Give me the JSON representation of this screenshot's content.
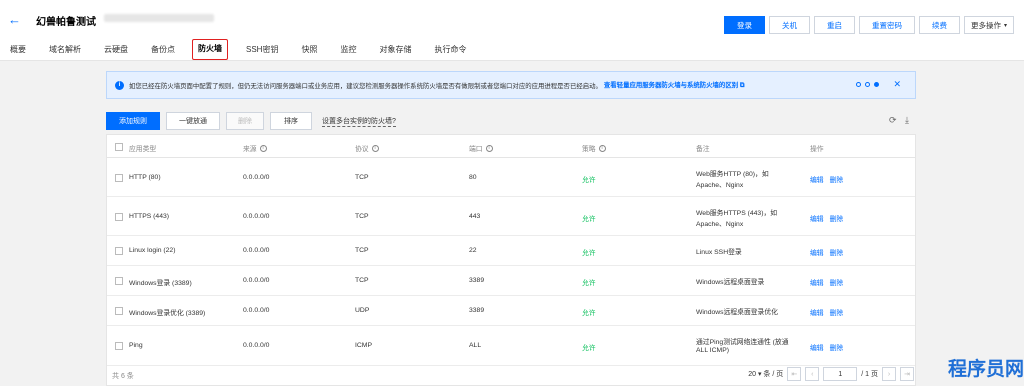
{
  "header": {
    "back_icon": "arrow-left-icon",
    "title": "幻兽帕鲁测试",
    "buttons": {
      "login": "登录",
      "shutdown": "关机",
      "restart": "重启",
      "reset_password": "重置密码",
      "renew": "续费",
      "more": "更多操作"
    }
  },
  "tabs": [
    "概要",
    "域名解析",
    "云硬盘",
    "备份点",
    "防火墙",
    "SSH密钥",
    "快照",
    "监控",
    "对象存储",
    "执行命令"
  ],
  "active_tab": "防火墙",
  "notice": {
    "text": "如您已经在防火墙页面中配置了规则，但仍无法访问服务器端口或业务应用，建议您检测服务器操作系统防火墙是否有做限制或者您端口对应的应用进程是否已经启动。",
    "link": "查看轻量应用服务器防火墙与系统防火墙的区别 ⧉"
  },
  "toolbar": {
    "add_rule": "添加规则",
    "allow_all": "一键放通",
    "delete": "删除",
    "sort": "排序",
    "multi_instance": "设置多台实例的防火墙?"
  },
  "table": {
    "columns": {
      "type": "应用类型",
      "source": "来源",
      "protocol": "协议",
      "port": "端口",
      "policy": "策略",
      "remark": "备注",
      "actions": "操作"
    },
    "action_edit": "编辑",
    "action_delete": "删除",
    "rows": [
      {
        "type": "HTTP (80)",
        "source": "0.0.0.0/0",
        "protocol": "TCP",
        "port": "80",
        "policy": "允许",
        "remark1": "Web服务HTTP (80)，如",
        "remark2": "Apache、Nginx"
      },
      {
        "type": "HTTPS (443)",
        "source": "0.0.0.0/0",
        "protocol": "TCP",
        "port": "443",
        "policy": "允许",
        "remark1": "Web服务HTTPS (443)，如",
        "remark2": "Apache、Nginx"
      },
      {
        "type": "Linux login (22)",
        "source": "0.0.0.0/0",
        "protocol": "TCP",
        "port": "22",
        "policy": "允许",
        "remark1": "Linux SSH登录",
        "remark2": ""
      },
      {
        "type": "Windows登录 (3389)",
        "source": "0.0.0.0/0",
        "protocol": "TCP",
        "port": "3389",
        "policy": "允许",
        "remark1": "Windows远程桌面登录",
        "remark2": ""
      },
      {
        "type": "Windows登录优化 (3389)",
        "source": "0.0.0.0/0",
        "protocol": "UDP",
        "port": "3389",
        "policy": "允许",
        "remark1": "Windows远程桌面登录优化",
        "remark2": ""
      },
      {
        "type": "Ping",
        "source": "0.0.0.0/0",
        "protocol": "ICMP",
        "port": "ALL",
        "policy": "允许",
        "remark1": "通过Ping测试网络连通性 (放通",
        "remark2": "ALL ICMP)"
      }
    ]
  },
  "footer": {
    "total": "共 6 条",
    "page_size": "20 ▾ 条 / 页",
    "page": "1",
    "page_total": "/ 1 页"
  },
  "watermark": "程序员网"
}
